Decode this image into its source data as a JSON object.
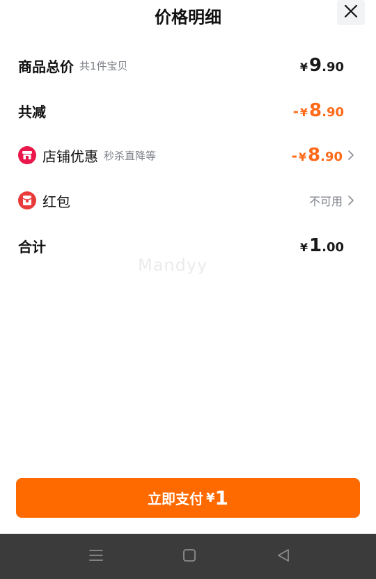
{
  "header": {
    "title": "价格明细"
  },
  "rows": {
    "total": {
      "label": "商品总价",
      "sub": "共1件宝贝",
      "yen": "¥",
      "int": "9",
      "dec": ".90"
    },
    "reduce": {
      "label": "共减",
      "minus": "-",
      "yen": "¥",
      "int": "8",
      "dec": ".90"
    },
    "store": {
      "label": "店铺优惠",
      "sub": "秒杀直降等",
      "minus": "-",
      "yen": "¥",
      "int": "8",
      "dec": ".90",
      "icon": "store-icon"
    },
    "redpack": {
      "label": "红包",
      "status": "不可用",
      "icon": "red-packet-icon"
    },
    "sum": {
      "label": "合计",
      "yen": "¥",
      "int": "1",
      "dec": ".00"
    }
  },
  "watermark": "Mandyy",
  "pay_button": {
    "label": "立即支付",
    "yen": "¥",
    "amount": "1"
  },
  "colors": {
    "accent": "#ff6a00",
    "discount": "#ff6a1a",
    "store_icon": "#e9174a",
    "redpack_icon": "#ea3b3b",
    "navbar": "#3b3b3b"
  },
  "navbar": {
    "icons": [
      "menu-icon",
      "home-icon",
      "back-icon"
    ]
  }
}
